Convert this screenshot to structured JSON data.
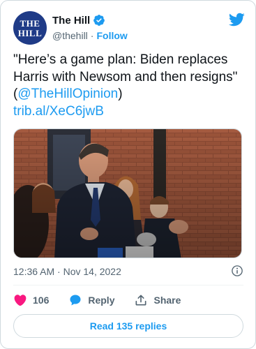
{
  "author": {
    "display_name": "The Hill",
    "handle": "@thehill",
    "separator": "·",
    "follow_label": "Follow",
    "avatar_line1": "THE",
    "avatar_line2": "HILL"
  },
  "tweet": {
    "text": "\"Here’s a game plan: Biden replaces Harris with Newsom and then resigns\" (",
    "mention": "@TheHillOpinion",
    "text_close": ")",
    "link": "trib.al/XeC6jwB",
    "timestamp": "12:36 AM · Nov 14, 2022"
  },
  "actions": {
    "like_count": "106",
    "reply_label": "Reply",
    "share_label": "Share"
  },
  "replies_button": "Read 135 replies",
  "colors": {
    "accent": "#1d9bf0",
    "like": "#f91880",
    "avatar_bg": "#1f3b87"
  },
  "icons": [
    "verified-badge-icon",
    "twitter-bird-icon",
    "info-icon",
    "heart-icon",
    "reply-bubble-icon",
    "share-icon"
  ]
}
